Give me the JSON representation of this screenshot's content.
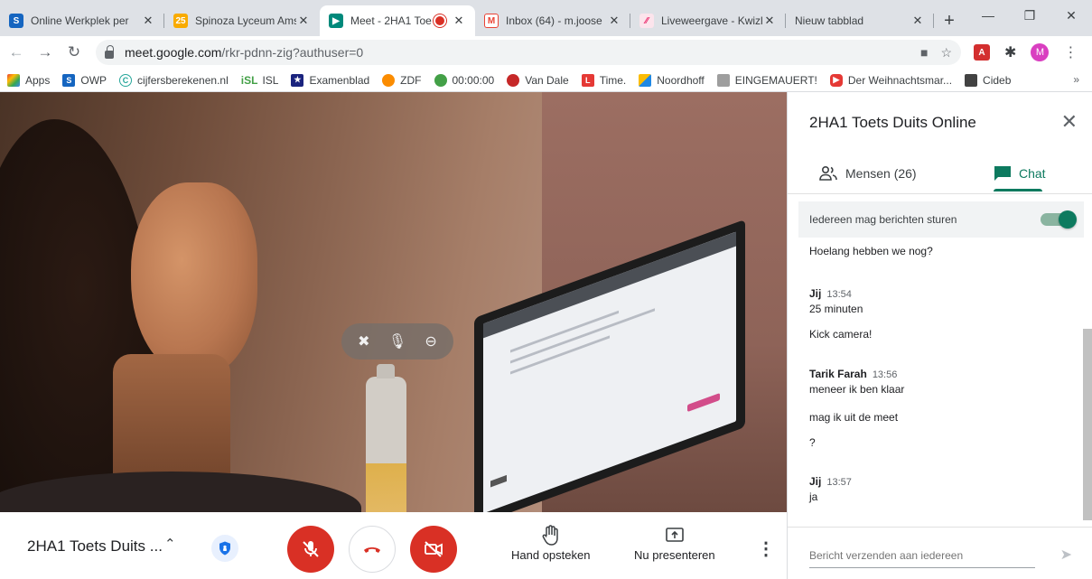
{
  "browser": {
    "tabs": [
      {
        "label": "Online Werkplek per",
        "favicon": "S",
        "color": "#1565c0"
      },
      {
        "label": "Spinoza Lyceum Ams",
        "favicon": "25",
        "color": "#f9ab00"
      },
      {
        "label": "Meet - 2HA1 Toe",
        "favicon": "meet",
        "color": "#00897b",
        "active": true,
        "recording": true
      },
      {
        "label": "Inbox (64) - m.joose",
        "favicon": "M",
        "color": "#ea4335"
      },
      {
        "label": "Liveweergave - Kwizl",
        "favicon": "k",
        "color": "#e91e63"
      },
      {
        "label": "Nieuw tabblad",
        "favicon": "",
        "color": ""
      }
    ],
    "new_tab": "+",
    "window_controls": {
      "minimize": "—",
      "restore": "❐",
      "close": "✕"
    },
    "url_host": "meet.google.com",
    "url_path": "/rkr-pdnn-zig?authuser=0",
    "profile_initial": "M",
    "bookmarks": [
      {
        "label": "Apps",
        "icon": "apps-grid",
        "color": "#ea4335"
      },
      {
        "label": "OWP",
        "icon": "S",
        "color": "#1565c0"
      },
      {
        "label": "cijfersberekenen.nl",
        "icon": "C",
        "color": "#26a69a"
      },
      {
        "label": "ISL",
        "icon": "iSL",
        "color": "#43a047"
      },
      {
        "label": "Examenblad",
        "icon": "E",
        "color": "#1a237e"
      },
      {
        "label": "ZDF",
        "icon": "zdf",
        "color": "#fb8c00"
      },
      {
        "label": "00:00:00",
        "icon": "clock",
        "color": "#43a047"
      },
      {
        "label": "Van Dale",
        "icon": "vd",
        "color": "#c62828"
      },
      {
        "label": "Time.",
        "icon": "L",
        "color": "#e53935"
      },
      {
        "label": "Noordhoff",
        "icon": "n",
        "color": "#1e88e5"
      },
      {
        "label": "EINGEMAUERT!",
        "icon": "ein",
        "color": "#616161"
      },
      {
        "label": "Der Weihnachtsmar...",
        "icon": "yt",
        "color": "#e53935"
      },
      {
        "label": "Cideb",
        "icon": "cid",
        "color": "#424242"
      }
    ],
    "bookmarks_more": "»"
  },
  "meet": {
    "meeting_name": "2HA1 Toets Duits ...",
    "actions": {
      "raise_hand": "Hand opsteken",
      "present": "Nu presenteren"
    }
  },
  "panel": {
    "title": "2HA1 Toets Duits Online",
    "tab_people": "Mensen (26)",
    "tab_chat": "Chat",
    "allow_messages_label": "Iedereen mag berichten sturen",
    "allow_messages_on": true,
    "messages": [
      {
        "sender": "",
        "time": "",
        "text": "Hoelang hebben we nog?"
      },
      {
        "sender": "Jij",
        "time": "13:54",
        "text": "25 minuten"
      },
      {
        "sender": "",
        "time": "",
        "text": "Kick camera!"
      },
      {
        "sender": "Tarik Farah",
        "time": "13:56",
        "text": "meneer ik ben klaar"
      },
      {
        "sender": "",
        "time": "",
        "text": "mag ik uit de meet"
      },
      {
        "sender": "",
        "time": "",
        "text": "?"
      },
      {
        "sender": "Jij",
        "time": "13:57",
        "text": "ja"
      }
    ],
    "send_placeholder": "Bericht verzenden aan iedereen"
  },
  "colors": {
    "accent": "#1a73e8",
    "danger": "#d93025",
    "toggle_on": "#0d7a5f"
  }
}
